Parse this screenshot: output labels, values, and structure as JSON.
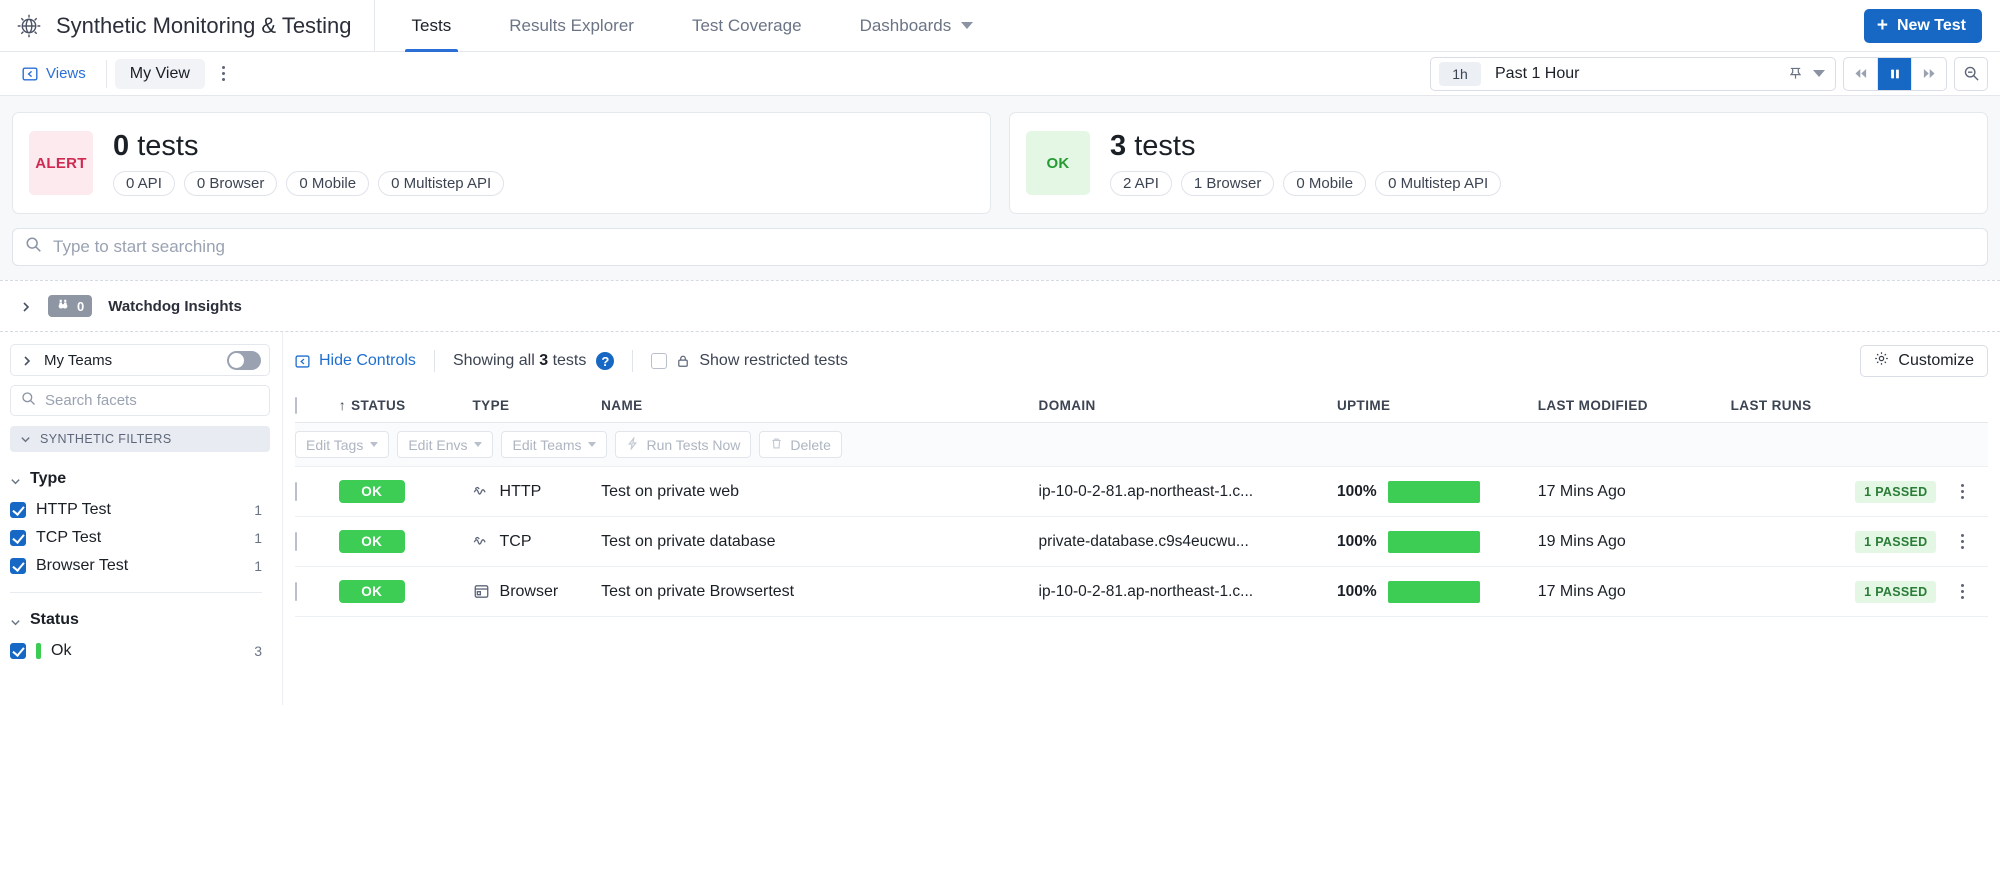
{
  "header": {
    "logo_icon": "synthetics-globe-icon",
    "title": "Synthetic Monitoring & Testing",
    "tabs": [
      {
        "label": "Tests",
        "active": true
      },
      {
        "label": "Results Explorer",
        "active": false
      },
      {
        "label": "Test Coverage",
        "active": false
      },
      {
        "label": "Dashboards",
        "active": false,
        "has_caret": true
      }
    ],
    "new_test_button": {
      "label": "New Test",
      "icon": "plus-icon",
      "color": "#1668c4"
    }
  },
  "views_bar": {
    "views_label": "Views",
    "views_icon": "panel-open-icon",
    "current_view": "My View",
    "kebab_icon": "more-options-icon",
    "time_picker": {
      "shortcut": "1h",
      "label": "Past 1 Hour",
      "pin_icon": "pin-icon",
      "caret_icon": "chevron-down-icon"
    },
    "playback": {
      "rewind_icon": "rewind-icon",
      "pause_icon": "pause-icon",
      "forward_icon": "fast-forward-icon",
      "active": "pause"
    },
    "zoom_out_icon": "zoom-out-icon"
  },
  "summary_cards": [
    {
      "status": "ALERT",
      "status_color": "#cf2b52",
      "status_bg": "#fdeaee",
      "count": "0",
      "count_unit": "tests",
      "pills": [
        "0 API",
        "0 Browser",
        "0 Mobile",
        "0 Multistep API"
      ]
    },
    {
      "status": "OK",
      "status_color": "#279b34",
      "status_bg": "#e3f7e4",
      "count": "3",
      "count_unit": "tests",
      "pills": [
        "2 API",
        "1 Browser",
        "0 Mobile",
        "0 Multistep API"
      ]
    }
  ],
  "global_search": {
    "placeholder": "Type to start searching",
    "value": "",
    "icon": "search-icon"
  },
  "watchdog": {
    "expand_icon": "chevron-right-icon",
    "badge_icon": "binoculars-icon",
    "badge_count": "0",
    "label": "Watchdog Insights"
  },
  "facets": {
    "my_teams": {
      "label": "My Teams",
      "expand_icon": "chevron-right-icon",
      "toggle_on": false
    },
    "search": {
      "placeholder": "Search facets",
      "value": "",
      "icon": "search-icon"
    },
    "group_header": {
      "label": "SYNTHETIC FILTERS",
      "collapse_icon": "chevron-down-icon"
    },
    "sections": [
      {
        "title": "Type",
        "collapse_icon": "chevron-down-icon",
        "items": [
          {
            "label": "HTTP Test",
            "count": "1",
            "checked": true
          },
          {
            "label": "TCP Test",
            "count": "1",
            "checked": true
          },
          {
            "label": "Browser Test",
            "count": "1",
            "checked": true
          }
        ]
      },
      {
        "title": "Status",
        "collapse_icon": "chevron-down-icon",
        "items": [
          {
            "label": "Ok",
            "count": "3",
            "checked": true,
            "swatch": "#3ccc52"
          }
        ]
      }
    ]
  },
  "table_controls": {
    "hide_controls": {
      "label": "Hide Controls",
      "icon": "collapse-panel-icon"
    },
    "showing_prefix": "Showing all ",
    "showing_count": "3",
    "showing_suffix": " tests",
    "help_icon": "help-icon",
    "show_restricted": {
      "label": "Show restricted tests",
      "checked": false,
      "lock_icon": "lock-icon"
    },
    "customize": {
      "label": "Customize",
      "icon": "gear-icon"
    }
  },
  "bulk_actions": [
    {
      "label": "Edit Tags",
      "has_caret": true
    },
    {
      "label": "Edit Envs",
      "has_caret": true
    },
    {
      "label": "Edit Teams",
      "has_caret": true
    },
    {
      "label": "Run Tests Now",
      "icon": "bolt-icon"
    },
    {
      "label": "Delete",
      "icon": "trash-icon"
    }
  ],
  "table": {
    "columns": [
      {
        "key": "checkbox",
        "label": ""
      },
      {
        "key": "status",
        "label": "STATUS",
        "sorted": true,
        "sort_dir": "asc"
      },
      {
        "key": "type",
        "label": "TYPE"
      },
      {
        "key": "name",
        "label": "NAME"
      },
      {
        "key": "domain",
        "label": "DOMAIN"
      },
      {
        "key": "uptime",
        "label": "UPTIME"
      },
      {
        "key": "last_modified",
        "label": "LAST MODIFIED"
      },
      {
        "key": "last_runs",
        "label": "LAST RUNS"
      }
    ],
    "rows": [
      {
        "checked": false,
        "status": "OK",
        "type": "HTTP",
        "type_icon": "http-pulse-icon",
        "name": "Test on private web",
        "domain": "ip-10-0-2-81.ap-northeast-1.c...",
        "uptime_pct": "100%",
        "uptime_value": 100,
        "last_modified": "17 Mins Ago",
        "last_runs": "1 PASSED",
        "kebab_icon": "more-options-icon"
      },
      {
        "checked": false,
        "status": "OK",
        "type": "TCP",
        "type_icon": "tcp-pulse-icon",
        "name": "Test on private database",
        "domain": "private-database.c9s4eucwu...",
        "uptime_pct": "100%",
        "uptime_value": 100,
        "last_modified": "19 Mins Ago",
        "last_runs": "1 PASSED",
        "kebab_icon": "more-options-icon"
      },
      {
        "checked": false,
        "status": "OK",
        "type": "Browser",
        "type_icon": "browser-window-icon",
        "name": "Test on private Browsertest",
        "domain": "ip-10-0-2-81.ap-northeast-1.c...",
        "uptime_pct": "100%",
        "uptime_value": 100,
        "last_modified": "17 Mins Ago",
        "last_runs": "1 PASSED",
        "kebab_icon": "more-options-icon"
      }
    ]
  },
  "colors": {
    "accent_blue": "#1668c4",
    "ok_green": "#3dcc54",
    "alert_red": "#cf2b52",
    "page_bg": "#f7f8fa"
  }
}
